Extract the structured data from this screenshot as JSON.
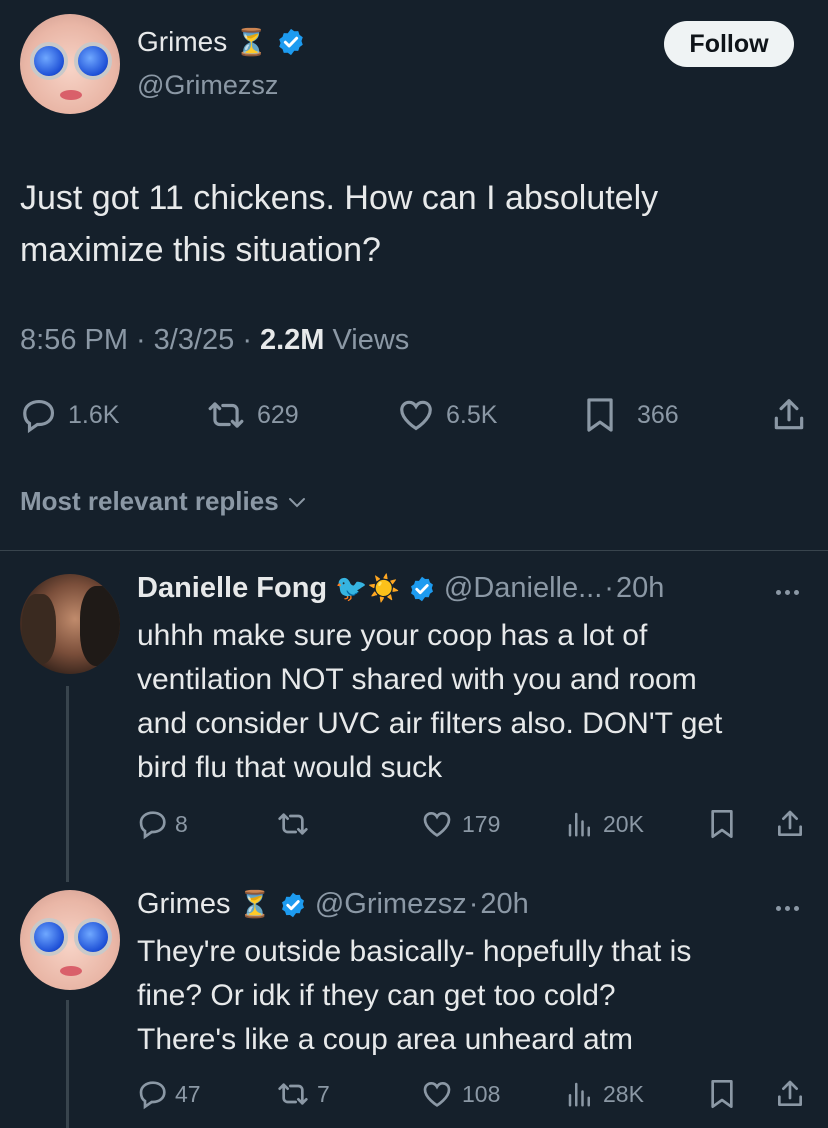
{
  "main_tweet": {
    "author_name": "Grimes",
    "author_handle": "@Grimezsz",
    "name_emoji": "⏳",
    "follow_label": "Follow",
    "text_line1": "Just got 11 chickens.  How can I absolutely",
    "text_line2": "maximize this situation?",
    "time": "8:56 PM",
    "date": "3/3/25",
    "views_count": "2.2M",
    "views_label": "Views",
    "replies": "1.6K",
    "reposts": "629",
    "likes": "6.5K",
    "bookmarks": "366"
  },
  "replies_header": "Most relevant replies",
  "replies": [
    {
      "author_name": "Danielle Fong",
      "name_emojis": "🐦☀️",
      "handle": "@Danielle...",
      "age": "20h",
      "lines": [
        "uhhh make sure your coop has a lot of",
        "ventilation NOT shared with you and room",
        "and consider UVC air filters also. DON'T get",
        "bird flu that would suck"
      ],
      "replies": "8",
      "reposts": "",
      "likes": "179",
      "views": "20K"
    },
    {
      "author_name": "Grimes",
      "name_emojis": "⏳",
      "handle": "@Grimezsz",
      "age": "20h",
      "lines": [
        "They're outside basically- hopefully that is",
        "fine?  Or idk if they can get too cold?",
        "There's like a coup area unheard atm"
      ],
      "replies": "47",
      "reposts": "7",
      "likes": "108",
      "views": "28K"
    }
  ],
  "colors": {
    "background": "#15202b",
    "text": "#e7e9ea",
    "muted": "#8b98a5",
    "verified": "#1d9bf0",
    "divider": "#38444d"
  }
}
